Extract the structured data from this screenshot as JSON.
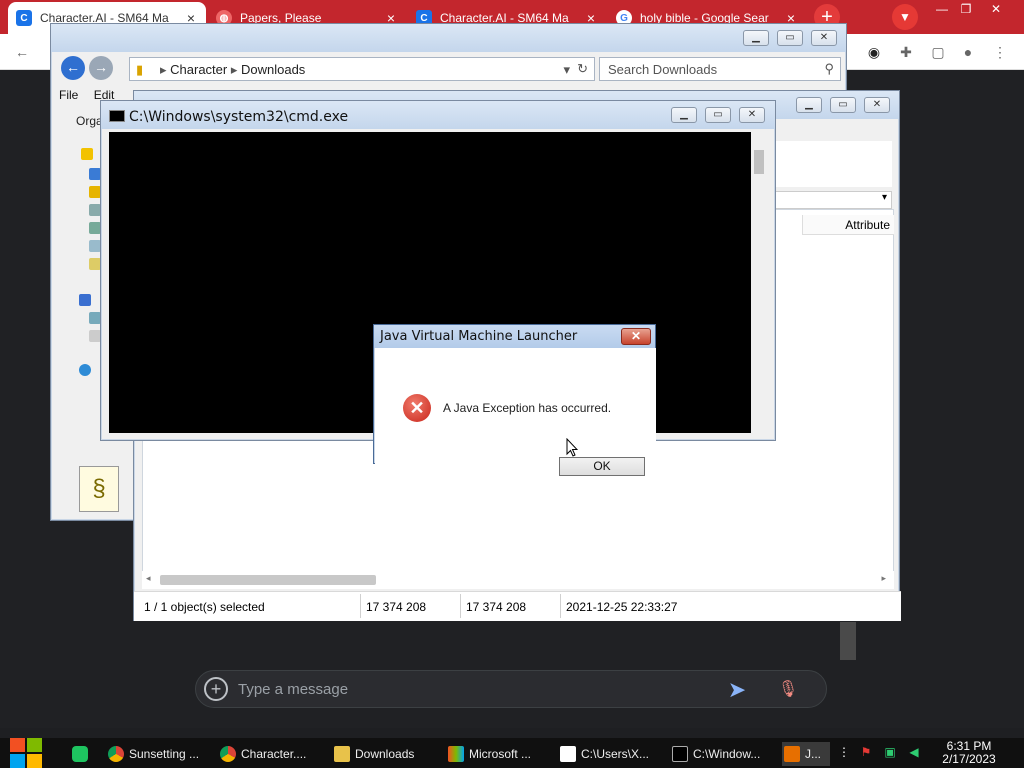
{
  "browser": {
    "tabs": [
      {
        "label": "Character.AI - SM64 Ma",
        "active": true,
        "icon": "character-ai-icon"
      },
      {
        "label": "Papers, Please",
        "active": false,
        "icon": "globe-icon"
      },
      {
        "label": "Character.AI - SM64 Ma",
        "active": false,
        "icon": "character-ai-icon"
      },
      {
        "label": "holy bible - Google Sear",
        "active": false,
        "icon": "google-icon"
      }
    ],
    "new_tab": "+",
    "accent": "#c3262d"
  },
  "explorer": {
    "address": [
      "Character",
      "Downloads"
    ],
    "search_placeholder": "Search Downloads",
    "menu": [
      "File",
      "Edit"
    ],
    "organize": "Orga"
  },
  "filemgr": {
    "column_header": "Attribute",
    "status": {
      "selected": "1 / 1 object(s) selected",
      "size": "17 374 208",
      "packed": "17 374 208",
      "modified": "2021-12-25 22:33:27"
    }
  },
  "cmd": {
    "title": "C:\\Windows\\system32\\cmd.exe"
  },
  "java_dialog": {
    "title": "Java Virtual Machine Launcher",
    "message": "A Java Exception has occurred.",
    "ok": "OK",
    "close": "✕"
  },
  "chat": {
    "placeholder": "Type a message"
  },
  "taskbar": {
    "items": [
      {
        "label": "Sunsetting ...",
        "icon": "chrome-icon"
      },
      {
        "label": "Character....",
        "icon": "chrome-icon"
      },
      {
        "label": "Downloads",
        "icon": "folder-icon"
      },
      {
        "label": "Microsoft ...",
        "icon": "office-icon"
      },
      {
        "label": "C:\\Users\\X...",
        "icon": "7zip-icon"
      },
      {
        "label": "C:\\Window...",
        "icon": "cmd-icon"
      },
      {
        "label": "J...",
        "icon": "java-icon"
      }
    ],
    "time": "6:31 PM",
    "date": "2/17/2023"
  }
}
